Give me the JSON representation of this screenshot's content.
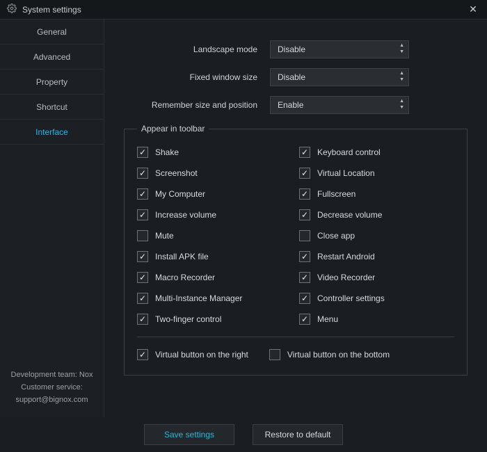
{
  "window": {
    "title": "System settings"
  },
  "sidebar": {
    "tabs": [
      {
        "label": "General"
      },
      {
        "label": "Advanced"
      },
      {
        "label": "Property"
      },
      {
        "label": "Shortcut"
      },
      {
        "label": "Interface"
      }
    ],
    "active_index": 4,
    "footer": {
      "line1": "Development team: Nox",
      "line2": "Customer service:",
      "line3": "support@bignox.com"
    }
  },
  "settings": {
    "landscape_mode": {
      "label": "Landscape mode",
      "value": "Disable"
    },
    "fixed_window": {
      "label": "Fixed window size",
      "value": "Disable"
    },
    "remember": {
      "label": "Remember size and position",
      "value": "Enable"
    }
  },
  "toolbar_group": {
    "legend": "Appear in toolbar",
    "left": [
      {
        "label": "Shake",
        "checked": true
      },
      {
        "label": "Screenshot",
        "checked": true
      },
      {
        "label": "My Computer",
        "checked": true
      },
      {
        "label": "Increase volume",
        "checked": true
      },
      {
        "label": "Mute",
        "checked": false
      },
      {
        "label": "Install APK file",
        "checked": true
      },
      {
        "label": "Macro Recorder",
        "checked": true
      },
      {
        "label": "Multi-Instance Manager",
        "checked": true
      },
      {
        "label": "Two-finger control",
        "checked": true
      }
    ],
    "right": [
      {
        "label": "Keyboard control",
        "checked": true
      },
      {
        "label": "Virtual Location",
        "checked": true
      },
      {
        "label": "Fullscreen",
        "checked": true
      },
      {
        "label": "Decrease volume",
        "checked": true
      },
      {
        "label": "Close app",
        "checked": false
      },
      {
        "label": "Restart Android",
        "checked": true
      },
      {
        "label": "Video Recorder",
        "checked": true
      },
      {
        "label": "Controller settings",
        "checked": true
      },
      {
        "label": "Menu",
        "checked": true
      }
    ],
    "bottom": [
      {
        "label": "Virtual button on the right",
        "checked": true
      },
      {
        "label": "Virtual button on the bottom",
        "checked": false
      }
    ]
  },
  "buttons": {
    "save": "Save settings",
    "restore": "Restore to default"
  }
}
